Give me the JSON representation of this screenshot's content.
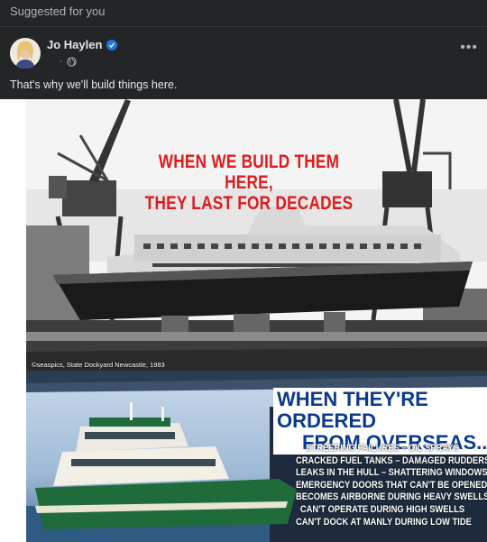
{
  "feed": {
    "suggested_label": "Suggested for you"
  },
  "post": {
    "author": "Jo Haylen",
    "meta_dot": "·",
    "caption": "That's why we'll build things here.",
    "more_icon": "more-options-icon"
  },
  "poster": {
    "headline_top": [
      "WHEN WE BUILD THEM HERE,",
      "THEY LAST FOR DECADES"
    ],
    "credit": "©seaspics, State Dockyard Newcastle, 1983",
    "headline_bottom": [
      "WHEN THEY'RE ORDERED",
      "FROM OVERSEAS..."
    ],
    "issues": [
      "STREERING FAILURES – OIL SPRAYS",
      "CRACKED FUEL TANKS – DAMAGED RUDDERS",
      "LEAKS IN THE HULL – SHATTERING WINDOWS",
      "EMERGENCY DOORS THAT CAN'T BE OPENED",
      "BECOMES AIRBORNE DURING HEAVY SWELLS",
      "CAN'T OPERATE DURING HIGH SWELLS",
      "CAN'T DOCK AT MANLY DURING LOW TIDE"
    ]
  },
  "colors": {
    "background": "#242526",
    "verified_badge": "#2374e1",
    "headline_red": "#e01a1a",
    "headline_blue": "#0a3a8e",
    "ferry_green": "#1f6b3a"
  }
}
